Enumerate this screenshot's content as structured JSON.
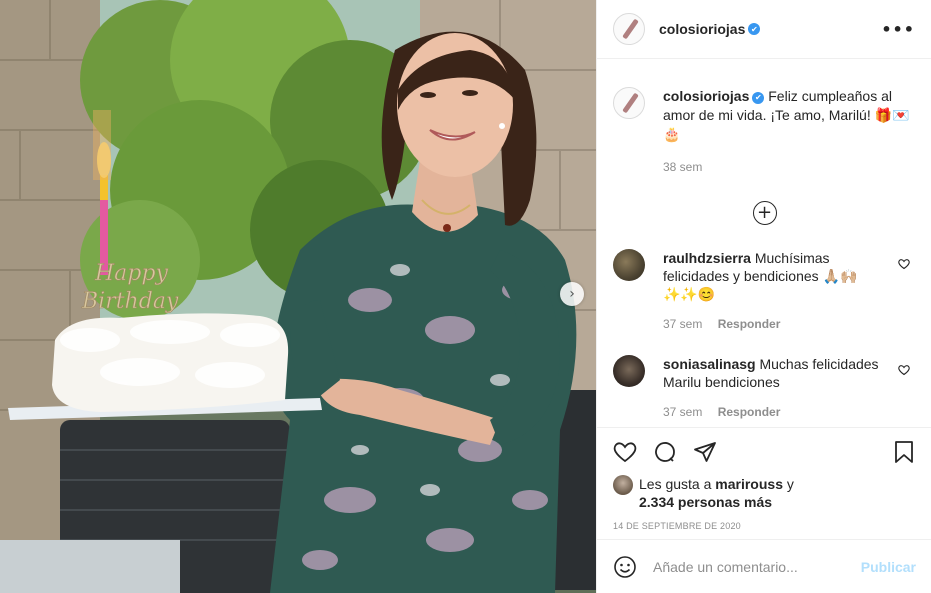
{
  "post": {
    "author": "colosioriojas",
    "verified_glyph": "✔",
    "more_label": "•••"
  },
  "photo": {
    "cake_topper": "Happy Birthday",
    "next_icon": "chevron-right-icon",
    "next_glyph": "›"
  },
  "caption": {
    "username": "colosioriojas",
    "text": "Feliz cumpleaños al amor de mi vida. ¡Te amo, Marilú! 🎁💌🎂",
    "time": "38 sem"
  },
  "load_more": {
    "glyph": "+"
  },
  "comments": [
    {
      "username": "raulhdzsierra",
      "text": "Muchísimas felicidades y bendiciones 🙏🏼🙌🏼✨✨😊",
      "time": "37 sem",
      "reply": "Responder"
    },
    {
      "username": "soniasalinasg",
      "text": "Muchas felicidades Marilu bendiciones",
      "time": "37 sem",
      "reply": "Responder"
    }
  ],
  "likes": {
    "prefix": "Les gusta a ",
    "first_user": "marirouss",
    "connector": " y",
    "others": "2.334 personas más"
  },
  "date": "14 de septiembre de 2020",
  "add_comment": {
    "placeholder": "Añade un comentario...",
    "post_label": "Publicar"
  },
  "colors": {
    "accent": "#0095f6",
    "post_disabled": "#b2dffc",
    "verified": "#3897f0",
    "muted": "#8e8e8e"
  }
}
